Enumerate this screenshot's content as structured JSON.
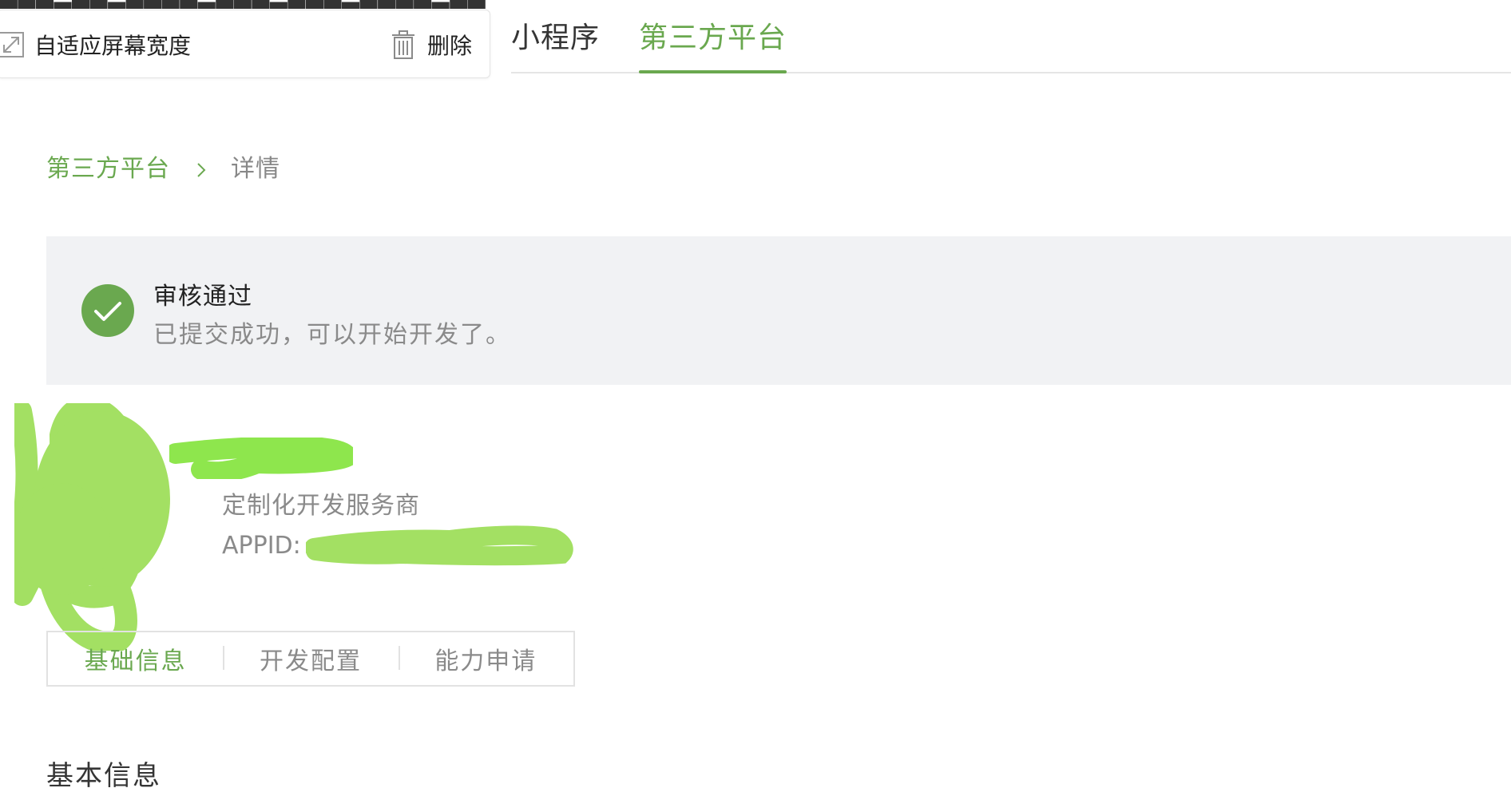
{
  "toolbar": {
    "fit_width_label": "自适应屏幕宽度",
    "delete_label": "删除"
  },
  "top_tabs": [
    {
      "label": "小程序",
      "active": false
    },
    {
      "label": "第三方平台",
      "active": true
    }
  ],
  "breadcrumb": {
    "parent": "第三方平台",
    "current": "详情"
  },
  "status": {
    "title": "审核通过",
    "description": "已提交成功，可以开始开发了。",
    "icon": "check-circle-icon"
  },
  "account": {
    "type": "定制化开发服务商",
    "appid_label": "APPID:"
  },
  "sub_tabs": [
    {
      "label": "基础信息",
      "active": true
    },
    {
      "label": "开发配置",
      "active": false
    },
    {
      "label": "能力申请",
      "active": false
    }
  ],
  "section": {
    "title": "基本信息"
  },
  "colors": {
    "accent": "#6aa84f",
    "banner_bg": "#f1f2f4",
    "redaction": "#9ee05a"
  }
}
